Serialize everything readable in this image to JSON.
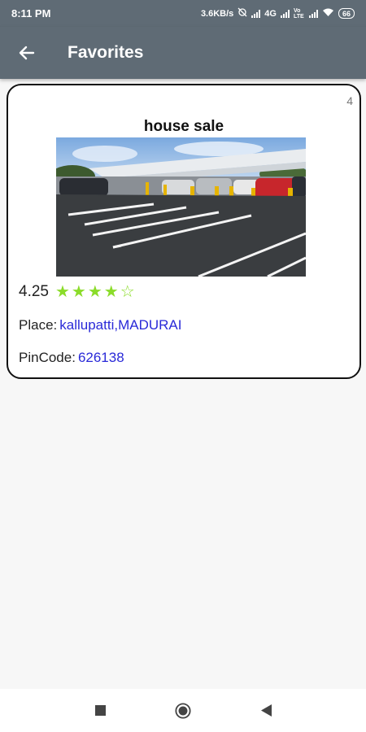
{
  "status_bar": {
    "time": "8:11 PM",
    "speed": "3.6KB/s",
    "network": "4G",
    "volte": "Vo LTE",
    "battery": "66"
  },
  "app_bar": {
    "title": "Favorites",
    "back_icon": "arrow-left-icon"
  },
  "card": {
    "count": "4",
    "title": "house sale",
    "image": "parking-lot-photo",
    "rating": "4.25",
    "stars": {
      "filled": 4,
      "total": 5
    },
    "place_label": "Place:",
    "place_value": "kallupatti,MADURAI",
    "pincode_label": "PinCode:",
    "pincode_value": "626138"
  },
  "nav_bar": {
    "recents_icon": "square-icon",
    "home_icon": "circle-icon",
    "back_icon": "triangle-back-icon"
  },
  "colors": {
    "app_bar": "#5f6b75",
    "star": "#8bdc2a",
    "value_text": "#2a2ad8"
  }
}
